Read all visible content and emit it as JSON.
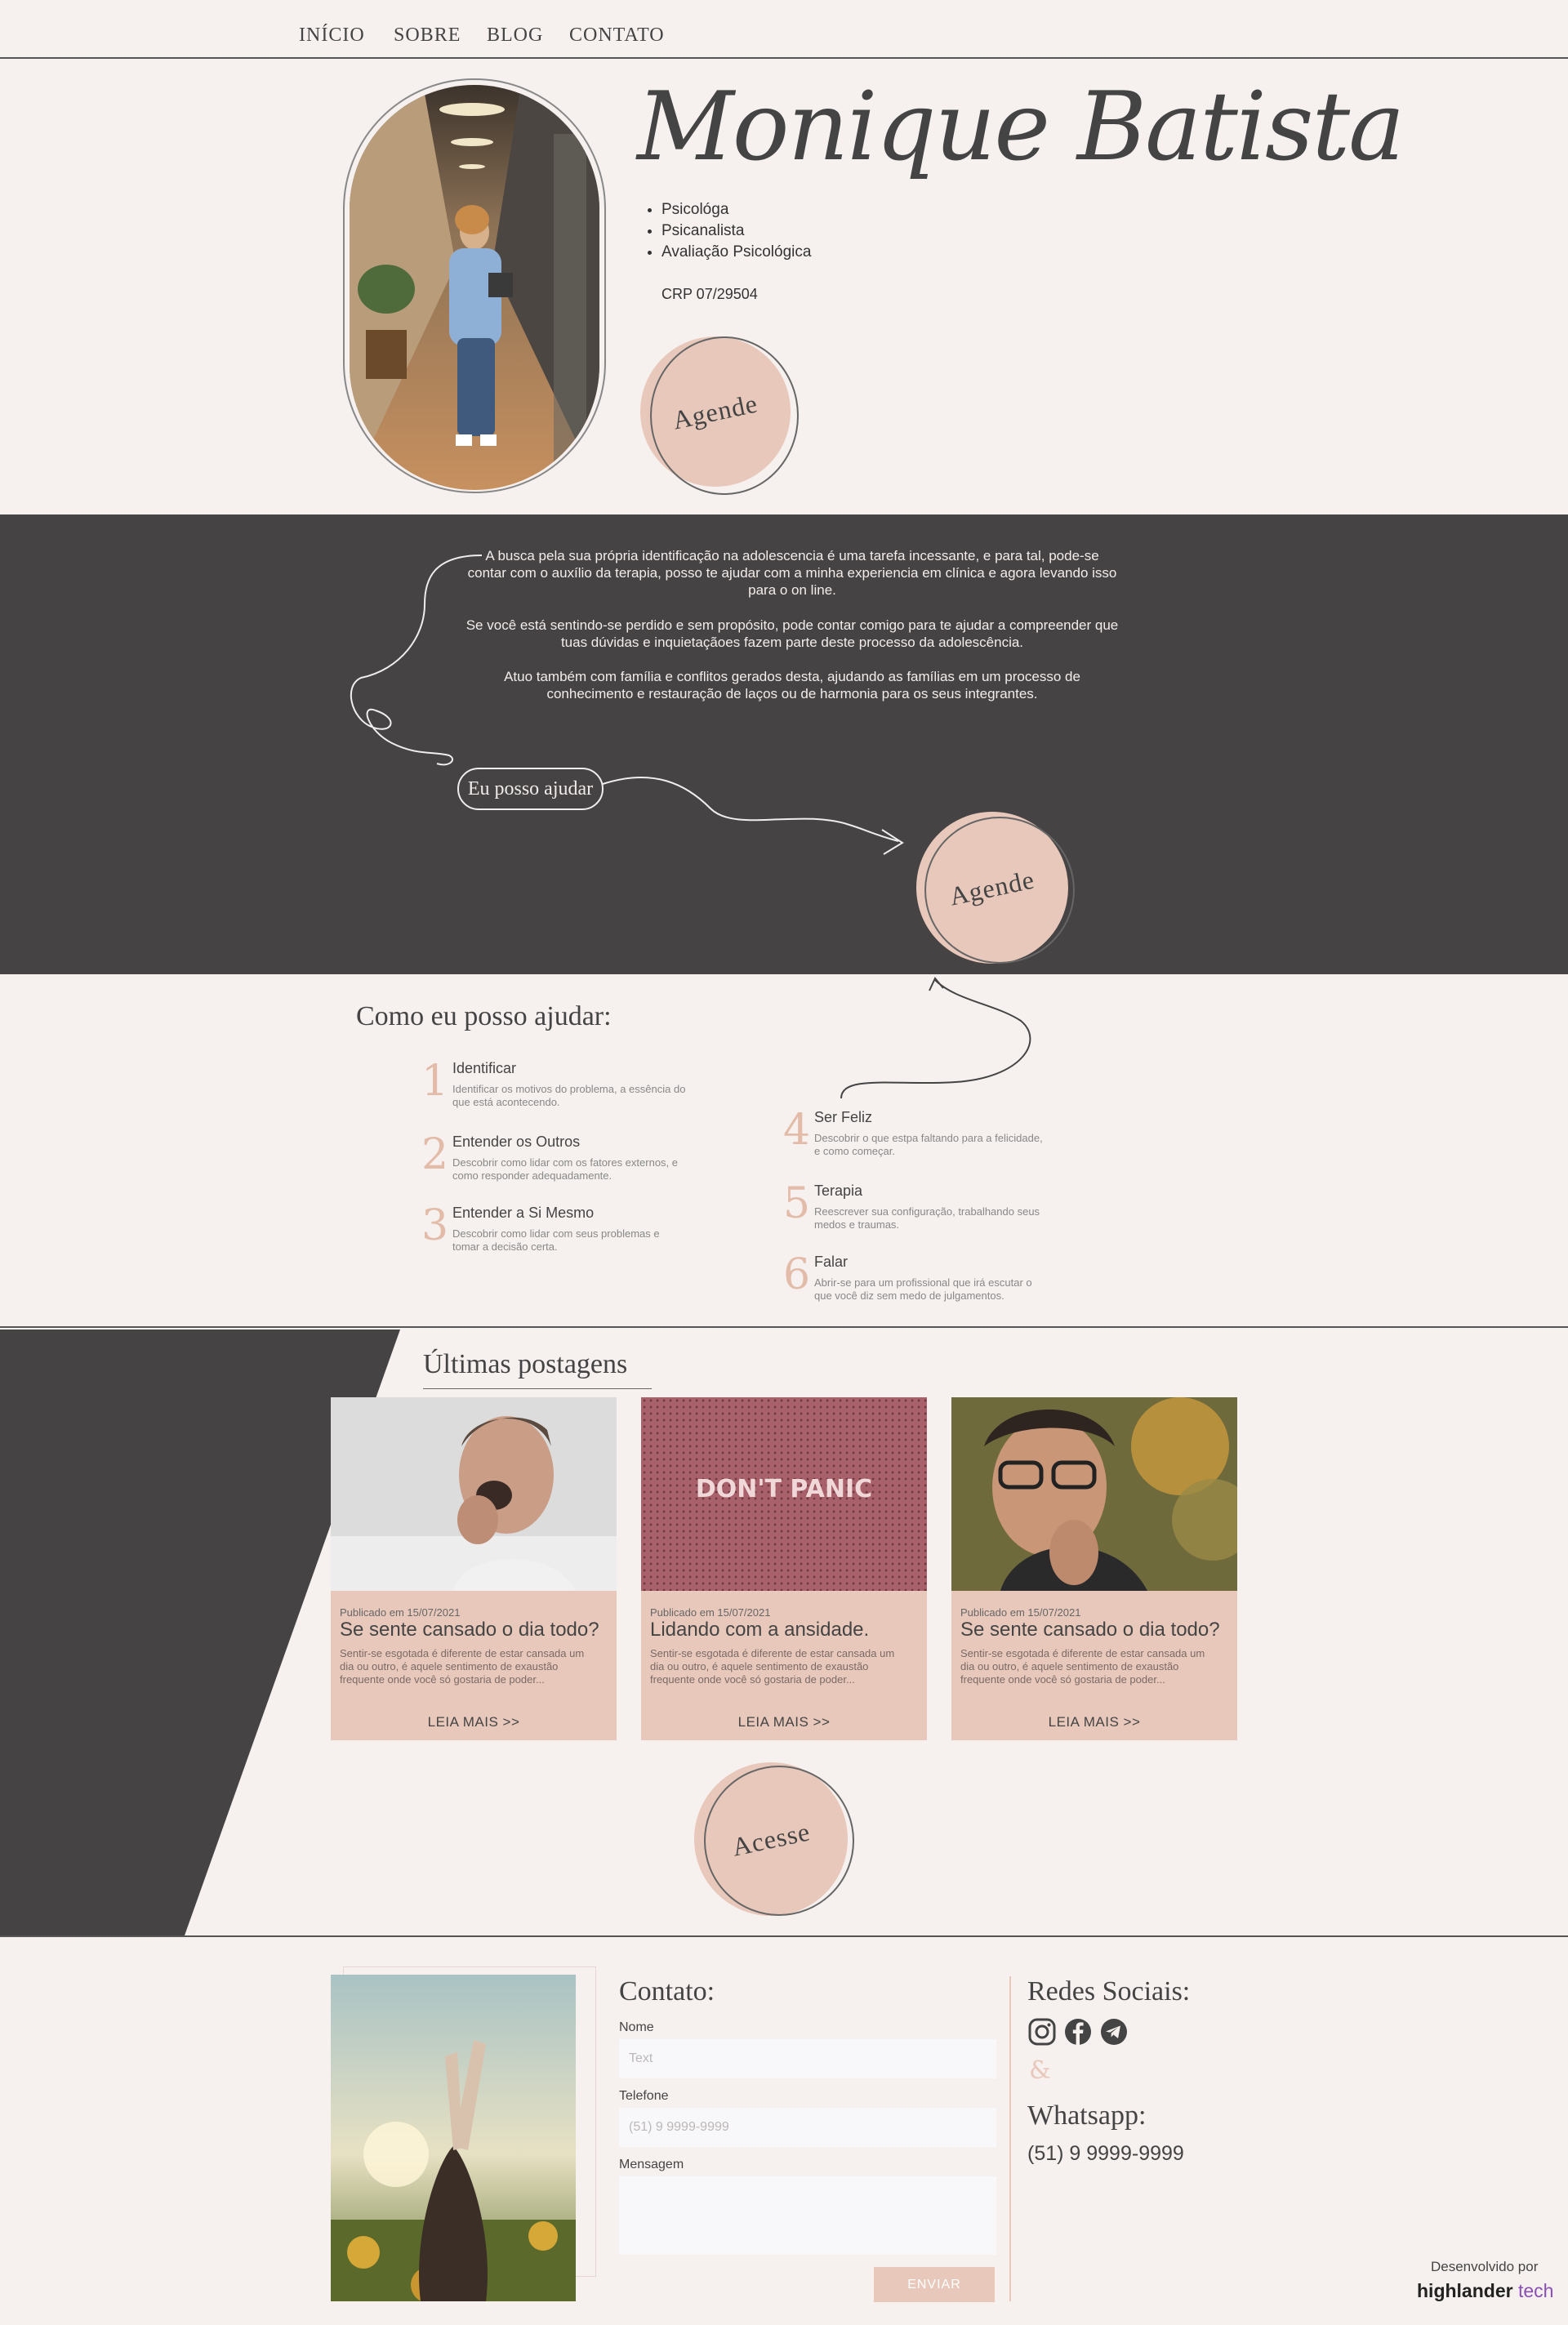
{
  "nav": {
    "items": [
      "INÍCIO",
      "SOBRE",
      "BLOG",
      "CONTATO"
    ]
  },
  "hero": {
    "name": "Monique Batista",
    "roles": [
      "Psicológa",
      "Psicanalista",
      "Avaliação Psicológica"
    ],
    "crp": "CRP 07/29504",
    "cta": "Agende"
  },
  "intro": {
    "paragraphs": [
      "A busca pela sua própria identificação na adolescencia é uma tarefa incessante, e para tal, pode-se contar com o auxílio da terapia, posso te ajudar com a minha experiencia em clínica e agora levando isso para o on line.",
      "Se você está sentindo-se perdido e sem propósito, pode contar comigo para te ajudar a compreender que tuas dúvidas e inquietaçãoes fazem parte deste processo da adolescência.",
      "Atuo também com família e conflitos gerados desta, ajudando as famílias em um processo de conhecimento e restauração de laços ou de harmonia para os seus integrantes."
    ],
    "pill": "Eu posso ajudar",
    "cta": "Agende"
  },
  "how": {
    "title": "Como eu posso ajudar:",
    "steps": [
      {
        "num": "1",
        "title": "Identificar",
        "desc": "Identificar os motivos do problema, a essência do que está acontecendo."
      },
      {
        "num": "2",
        "title": "Entender os Outros",
        "desc": "Descobrir como lidar com os fatores externos, e como responder adequadamente."
      },
      {
        "num": "3",
        "title": "Entender a Si Mesmo",
        "desc": "Descobrir como lidar com seus problemas e tomar a decisão certa."
      },
      {
        "num": "4",
        "title": "Ser Feliz",
        "desc": "Descobrir o que estpa faltando para a felicidade, e como começar."
      },
      {
        "num": "5",
        "title": "Terapia",
        "desc": "Reescrever sua configuração, trabalhando seus medos e traumas."
      },
      {
        "num": "6",
        "title": "Falar",
        "desc": "Abrir-se para um profissional que irá escutar o que você diz sem medo de julgamentos."
      }
    ]
  },
  "blog": {
    "title": "Últimas postagens",
    "posts": [
      {
        "date": "Publicado em 15/07/2021",
        "title": "Se sente cansado o dia todo?",
        "excerpt": "Sentir-se esgotada é diferente de estar cansada um dia ou outro, é aquele sentimento de exaustão frequente onde você só gostaria de poder...",
        "more": "LEIA MAIS >>"
      },
      {
        "date": "Publicado em 15/07/2021",
        "title": "Lidando com a ansidade.",
        "excerpt": "Sentir-se esgotada é diferente de estar cansada um dia ou outro, é aquele sentimento de exaustão frequente onde você só gostaria de poder...",
        "more": "LEIA MAIS >>",
        "image_text": "DON'T PANIC"
      },
      {
        "date": "Publicado em 15/07/2021",
        "title": "Se sente cansado o dia todo?",
        "excerpt": "Sentir-se esgotada é diferente de estar cansada um dia ou outro, é aquele sentimento de exaustão frequente onde você só gostaria de poder...",
        "more": "LEIA MAIS >>"
      }
    ],
    "cta": "Acesse"
  },
  "contact": {
    "title": "Contato:",
    "name_label": "Nome",
    "name_placeholder": "Text",
    "phone_label": "Telefone",
    "phone_placeholder": "(51) 9 9999-9999",
    "message_label": "Mensagem",
    "send": "ENVIAR"
  },
  "social": {
    "title": "Redes Sociais:",
    "icons": [
      "instagram-icon",
      "facebook-icon",
      "telegram-icon"
    ],
    "ampersand": "&",
    "whatsapp_title": "Whatsapp:",
    "whatsapp_number": "(51) 9 9999-9999"
  },
  "credits": {
    "label": "Desenvolvido por",
    "brand_a": "highlander",
    "brand_b": "tech"
  },
  "colors": {
    "background": "#f6f0ef",
    "dark": "#454343",
    "accent": "#e8c8bb",
    "number": "#e3bca9",
    "brand": "#8a4fb5"
  }
}
